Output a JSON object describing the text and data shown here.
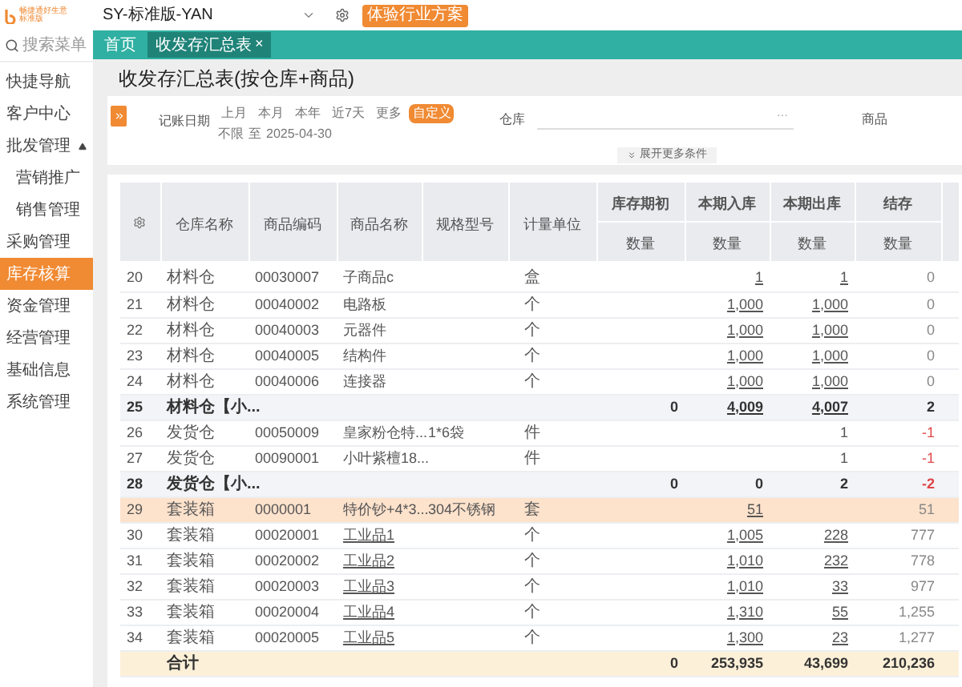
{
  "logo": {
    "name": "畅捷通好生意",
    "edition": "标准版"
  },
  "top_bar": {
    "account": "SY-标准版-YAN",
    "promo_button": "体验行业方案"
  },
  "sidebar": {
    "search_placeholder": "搜索菜单",
    "items": [
      {
        "label": "快捷导航",
        "selected": false
      },
      {
        "label": "客户中心",
        "selected": false
      },
      {
        "label": "批发管理",
        "selected": false,
        "expanded": true,
        "children": [
          {
            "label": "营销推广",
            "selected": false
          },
          {
            "label": "销售管理",
            "selected": false
          }
        ]
      },
      {
        "label": "采购管理",
        "selected": false
      },
      {
        "label": "库存核算",
        "selected": true
      },
      {
        "label": "资金管理",
        "selected": false
      },
      {
        "label": "经营管理",
        "selected": false
      },
      {
        "label": "基础信息",
        "selected": false
      },
      {
        "label": "系统管理",
        "selected": false
      }
    ]
  },
  "tabs": [
    {
      "label": "首页",
      "selected": false
    },
    {
      "label": "收发存汇总表",
      "selected": true,
      "close": "×"
    }
  ],
  "page_title": "收发存汇总表(按仓库+商品)",
  "filters": {
    "date_label": "记账日期",
    "presets": [
      {
        "label": "上月",
        "selected": false
      },
      {
        "label": "本月",
        "selected": false
      },
      {
        "label": "本年",
        "selected": false
      },
      {
        "label": "近7天",
        "selected": false
      },
      {
        "label": "更多",
        "selected": false
      },
      {
        "label": "自定义",
        "selected": true
      }
    ],
    "date_from": "不限",
    "date_sep": "至",
    "date_to": "2025-04-30",
    "warehouse_label": "仓库",
    "warehouse_more": "···",
    "product_label": "商品",
    "expand_button": "展开更多条件"
  },
  "table": {
    "columns": [
      "仓库名称",
      "商品编码",
      "商品名称",
      "规格型号",
      "计量单位"
    ],
    "groups": [
      {
        "label": "库存期初",
        "sub": "数量"
      },
      {
        "label": "本期入库",
        "sub": "数量"
      },
      {
        "label": "本期出库",
        "sub": "数量"
      },
      {
        "label": "结存",
        "sub": "数量"
      }
    ],
    "rows": [
      {
        "kind": "item",
        "no": "20",
        "warehouse": "材料仓",
        "code": "00030007",
        "name": "子商品c",
        "spec": "",
        "unit": "盒",
        "opening": "",
        "in": "1",
        "out": "1",
        "balance": "0",
        "linked": true,
        "name_linked": false,
        "negative": false,
        "selected": false
      },
      {
        "kind": "item",
        "no": "21",
        "warehouse": "材料仓",
        "code": "00040002",
        "name": "电路板",
        "spec": "",
        "unit": "个",
        "opening": "",
        "in": "1,000",
        "out": "1,000",
        "balance": "0",
        "linked": true,
        "name_linked": false,
        "negative": false,
        "selected": false
      },
      {
        "kind": "item",
        "no": "22",
        "warehouse": "材料仓",
        "code": "00040003",
        "name": "元器件",
        "spec": "",
        "unit": "个",
        "opening": "",
        "in": "1,000",
        "out": "1,000",
        "balance": "0",
        "linked": true,
        "name_linked": false,
        "negative": false,
        "selected": false
      },
      {
        "kind": "item",
        "no": "23",
        "warehouse": "材料仓",
        "code": "00040005",
        "name": "结构件",
        "spec": "",
        "unit": "个",
        "opening": "",
        "in": "1,000",
        "out": "1,000",
        "balance": "0",
        "linked": true,
        "name_linked": false,
        "negative": false,
        "selected": false
      },
      {
        "kind": "item",
        "no": "24",
        "warehouse": "材料仓",
        "code": "00040006",
        "name": "连接器",
        "spec": "",
        "unit": "个",
        "opening": "",
        "in": "1,000",
        "out": "1,000",
        "balance": "0",
        "linked": true,
        "name_linked": false,
        "negative": false,
        "selected": false
      },
      {
        "kind": "subtotal",
        "no": "25",
        "warehouse": "材料仓【小...",
        "opening": "0",
        "in": "4,009",
        "out": "4,007",
        "balance": "2",
        "linked": true,
        "negative": false,
        "selected": false
      },
      {
        "kind": "item",
        "no": "26",
        "warehouse": "发货仓",
        "code": "00050009",
        "name": "皇家粉仓特...",
        "spec": "1*6袋",
        "unit": "件",
        "opening": "",
        "in": "",
        "out": "1",
        "balance": "-1",
        "linked": false,
        "name_linked": false,
        "negative": true,
        "selected": false
      },
      {
        "kind": "item",
        "no": "27",
        "warehouse": "发货仓",
        "code": "00090001",
        "name": "小叶紫檀18...",
        "spec": "",
        "unit": "件",
        "opening": "",
        "in": "",
        "out": "1",
        "balance": "-1",
        "linked": false,
        "name_linked": false,
        "negative": true,
        "selected": false
      },
      {
        "kind": "subtotal",
        "no": "28",
        "warehouse": "发货仓【小...",
        "opening": "0",
        "in": "0",
        "out": "2",
        "balance": "-2",
        "linked": false,
        "negative": true,
        "selected": false
      },
      {
        "kind": "item",
        "no": "29",
        "warehouse": "套装箱",
        "code": "0000001",
        "name": "特价钞+4*3...",
        "spec": "304不锈钢",
        "unit": "套",
        "opening": "",
        "in": "51",
        "out": "",
        "balance": "51",
        "linked": true,
        "name_linked": false,
        "negative": false,
        "selected": true
      },
      {
        "kind": "item",
        "no": "30",
        "warehouse": "套装箱",
        "code": "00020001",
        "name": "工业品1",
        "spec": "",
        "unit": "个",
        "opening": "",
        "in": "1,005",
        "out": "228",
        "balance": "777",
        "linked": true,
        "name_linked": true,
        "negative": false,
        "selected": false
      },
      {
        "kind": "item",
        "no": "31",
        "warehouse": "套装箱",
        "code": "00020002",
        "name": "工业品2",
        "spec": "",
        "unit": "个",
        "opening": "",
        "in": "1,010",
        "out": "232",
        "balance": "778",
        "linked": true,
        "name_linked": true,
        "negative": false,
        "selected": false
      },
      {
        "kind": "item",
        "no": "32",
        "warehouse": "套装箱",
        "code": "00020003",
        "name": "工业品3",
        "spec": "",
        "unit": "个",
        "opening": "",
        "in": "1,010",
        "out": "33",
        "balance": "977",
        "linked": true,
        "name_linked": true,
        "negative": false,
        "selected": false
      },
      {
        "kind": "item",
        "no": "33",
        "warehouse": "套装箱",
        "code": "00020004",
        "name": "工业品4",
        "spec": "",
        "unit": "个",
        "opening": "",
        "in": "1,310",
        "out": "55",
        "balance": "1,255",
        "linked": true,
        "name_linked": true,
        "negative": false,
        "selected": false
      },
      {
        "kind": "item",
        "no": "34",
        "warehouse": "套装箱",
        "code": "00020005",
        "name": "工业品5",
        "spec": "",
        "unit": "个",
        "opening": "",
        "in": "1,300",
        "out": "23",
        "balance": "1,277",
        "linked": true,
        "name_linked": true,
        "negative": false,
        "selected": false
      },
      {
        "kind": "total",
        "warehouse": "合计",
        "opening": "0",
        "in": "253,935",
        "out": "43,699",
        "balance": "210,236",
        "negative": false,
        "selected": false
      }
    ]
  }
}
